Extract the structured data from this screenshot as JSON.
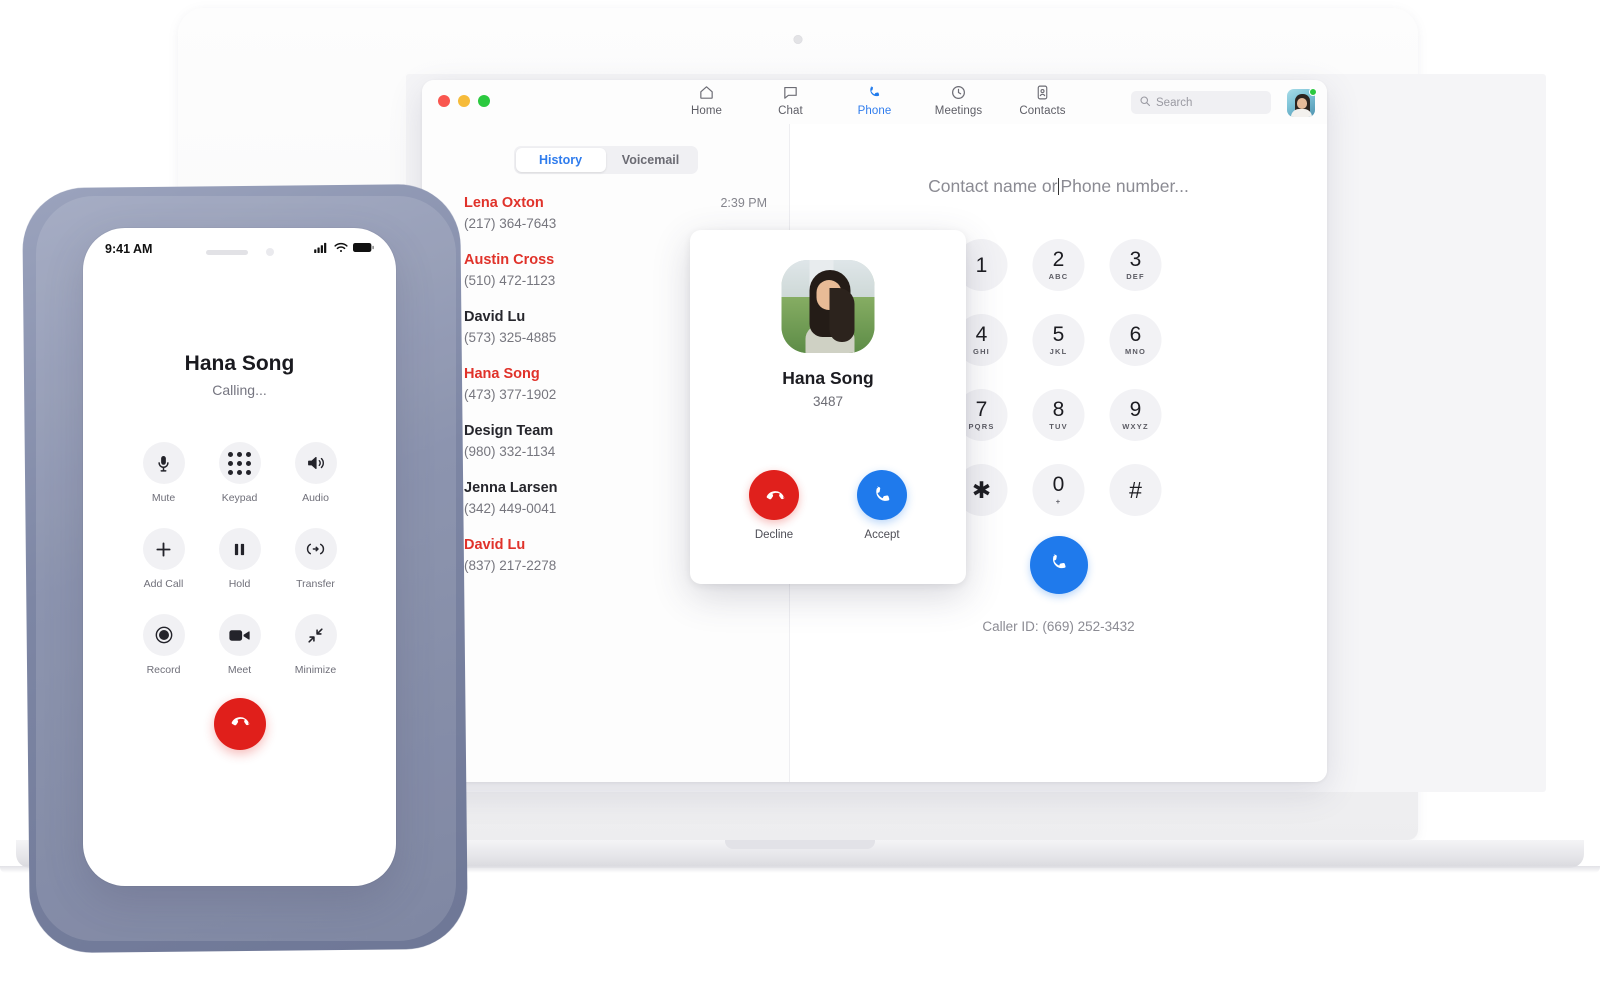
{
  "desktop_app": {
    "window_controls": [
      "close",
      "minimize",
      "maximize"
    ],
    "nav": [
      {
        "label": "Home",
        "icon": "home-icon",
        "active": false
      },
      {
        "label": "Chat",
        "icon": "chat-icon",
        "active": false
      },
      {
        "label": "Phone",
        "icon": "phone-icon",
        "active": true
      },
      {
        "label": "Meetings",
        "icon": "clock-icon",
        "active": false
      },
      {
        "label": "Contacts",
        "icon": "contacts-icon",
        "active": false
      }
    ],
    "search": {
      "placeholder": "Search",
      "icon": "search-icon"
    },
    "profile": {
      "name": "avatar",
      "presence": "available"
    },
    "tabs": [
      {
        "label": "History",
        "active": true
      },
      {
        "label": "Voicemail",
        "active": false
      }
    ],
    "call_history": [
      {
        "name": "Lena Oxton",
        "number": "(217) 364-7643",
        "missed": true,
        "direction": "",
        "time": "2:39 PM"
      },
      {
        "name": "Austin Cross",
        "number": "(510) 472-1123",
        "missed": true,
        "direction": "",
        "time": ""
      },
      {
        "name": "David Lu",
        "number": "(573) 325-4885",
        "missed": false,
        "direction": "outgoing",
        "time": ""
      },
      {
        "name": "Hana Song",
        "number": "(473) 377-1902",
        "missed": true,
        "direction": "",
        "time": ""
      },
      {
        "name": "Design Team",
        "number": "(980) 332-1134",
        "missed": false,
        "direction": "outgoing",
        "time": ""
      },
      {
        "name": "Jenna Larsen",
        "number": "(342) 449-0041",
        "missed": false,
        "direction": "",
        "time": ""
      },
      {
        "name": "David Lu",
        "number": "(837) 217-2278",
        "missed": true,
        "direction": "",
        "time": ""
      }
    ],
    "dialer": {
      "input_placeholder_left": "Contact name or",
      "input_placeholder_right": "Phone number...",
      "caller_id": "Caller ID: (669) 252-3432",
      "keys": [
        {
          "digit": "1",
          "letters": ""
        },
        {
          "digit": "2",
          "letters": "ABC"
        },
        {
          "digit": "3",
          "letters": "DEF"
        },
        {
          "digit": "4",
          "letters": "GHI"
        },
        {
          "digit": "5",
          "letters": "JKL"
        },
        {
          "digit": "6",
          "letters": "MNO"
        },
        {
          "digit": "7",
          "letters": "PQRS"
        },
        {
          "digit": "8",
          "letters": "TUV"
        },
        {
          "digit": "9",
          "letters": "WXYZ"
        },
        {
          "digit": "✱",
          "letters": ""
        },
        {
          "digit": "0",
          "letters": "+"
        },
        {
          "digit": "#",
          "letters": ""
        }
      ],
      "call_button": "call-icon"
    },
    "incoming_call": {
      "name": "Hana Song",
      "extension": "3487",
      "decline_label": "Decline",
      "accept_label": "Accept"
    }
  },
  "mobile_app": {
    "status_bar": {
      "time": "9:41 AM",
      "signal": "signal-icon",
      "wifi": "wifi-icon",
      "battery": "battery-icon"
    },
    "call": {
      "name": "Hana Song",
      "status": "Calling..."
    },
    "controls": [
      {
        "label": "Mute",
        "icon": "microphone-icon"
      },
      {
        "label": "Keypad",
        "icon": "keypad-icon"
      },
      {
        "label": "Audio",
        "icon": "speaker-icon"
      },
      {
        "label": "Add Call",
        "icon": "plus-icon"
      },
      {
        "label": "Hold",
        "icon": "pause-icon"
      },
      {
        "label": "Transfer",
        "icon": "transfer-icon"
      },
      {
        "label": "Record",
        "icon": "record-icon"
      },
      {
        "label": "Meet",
        "icon": "video-icon"
      },
      {
        "label": "Minimize",
        "icon": "minimize-icon"
      }
    ],
    "end_call": {
      "icon": "end-call-icon"
    }
  },
  "colors": {
    "accent_blue": "#1f7aec",
    "missed_red": "#e0322a",
    "decline_red": "#e0201c",
    "presence_green": "#2bc93f"
  }
}
